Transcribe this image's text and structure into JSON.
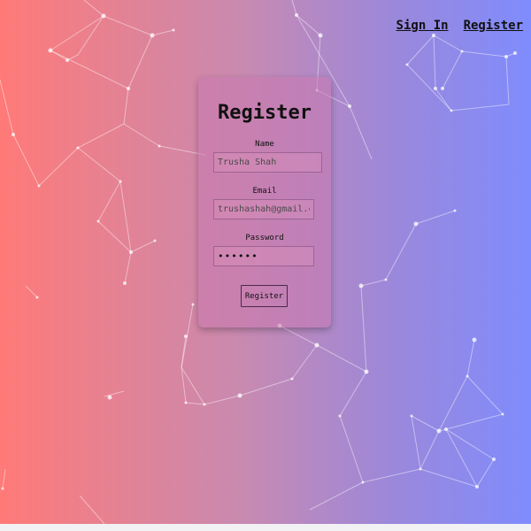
{
  "nav": {
    "sign_in": "Sign In",
    "register": "Register"
  },
  "form": {
    "title": "Register",
    "name_label": "Name",
    "name_placeholder": "Trusha Shah",
    "email_label": "Email",
    "email_placeholder": "trushashah@gmail.com",
    "password_label": "Password",
    "password_value": "••••••",
    "submit_label": "Register"
  },
  "colors": {
    "gradient_left": "#ff7a78",
    "gradient_right": "#7f8cfd",
    "card_tint": "#c878af"
  }
}
